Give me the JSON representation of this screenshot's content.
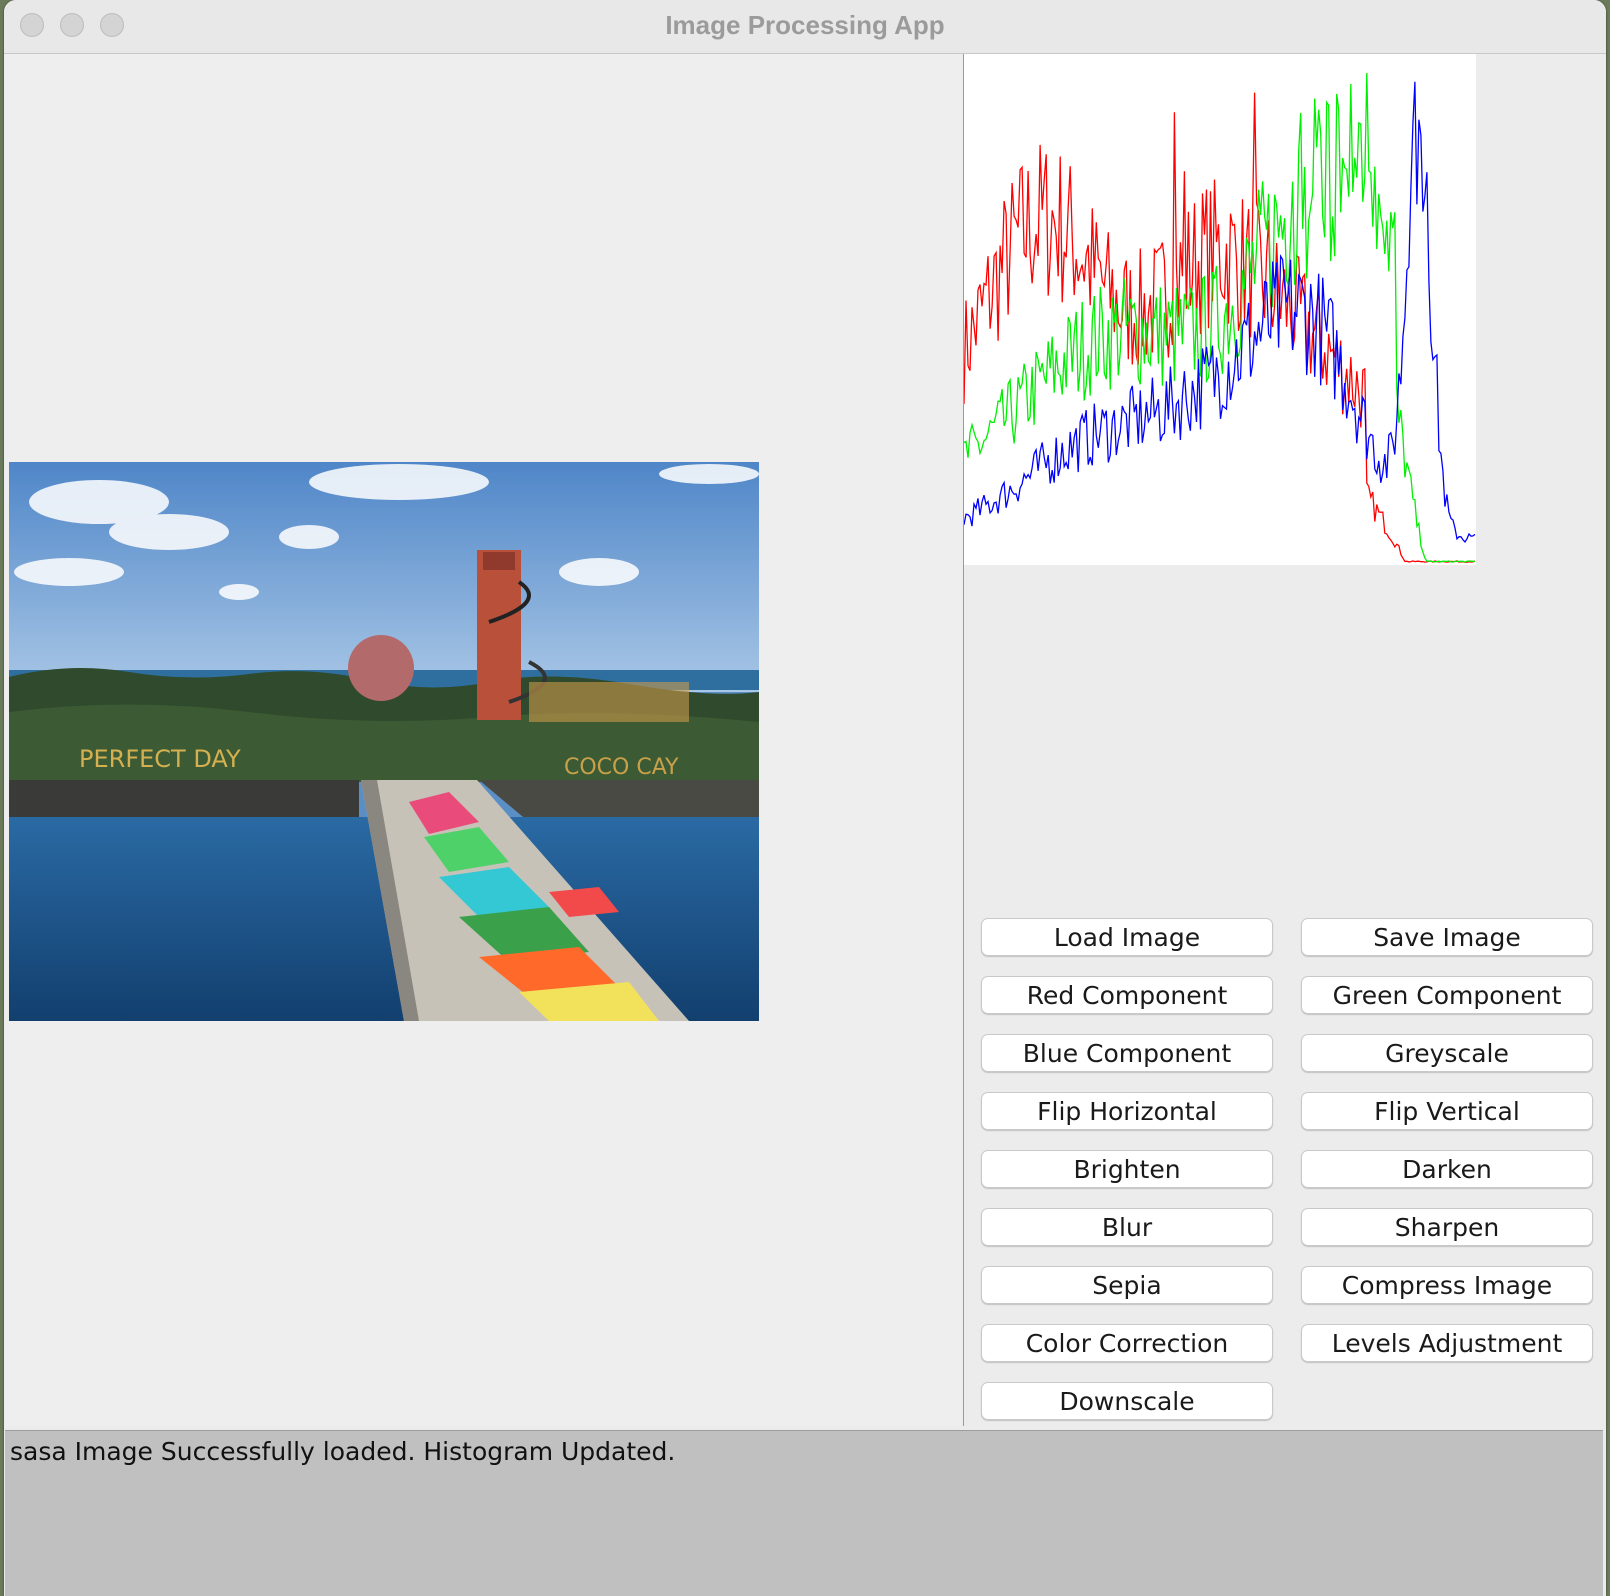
{
  "window": {
    "title": "Image Processing App"
  },
  "image_panel": {
    "sign_left": "PERFECT DAY",
    "sign_right": "COCO CAY"
  },
  "histogram": {
    "series": [
      {
        "color": "#ff0000"
      },
      {
        "color": "#00ee00"
      },
      {
        "color": "#0000ff"
      }
    ]
  },
  "buttons": [
    {
      "label": "Load Image"
    },
    {
      "label": "Save Image"
    },
    {
      "label": "Red Component"
    },
    {
      "label": "Green Component"
    },
    {
      "label": "Blue Component"
    },
    {
      "label": "Greyscale"
    },
    {
      "label": "Flip Horizontal"
    },
    {
      "label": "Flip Vertical"
    },
    {
      "label": "Brighten"
    },
    {
      "label": "Darken"
    },
    {
      "label": "Blur"
    },
    {
      "label": "Sharpen"
    },
    {
      "label": "Sepia"
    },
    {
      "label": "Compress Image"
    },
    {
      "label": "Color Correction"
    },
    {
      "label": "Levels Adjustment"
    },
    {
      "label": "Downscale"
    }
  ],
  "status": {
    "message": "sasa Image Successfully loaded. Histogram Updated."
  }
}
